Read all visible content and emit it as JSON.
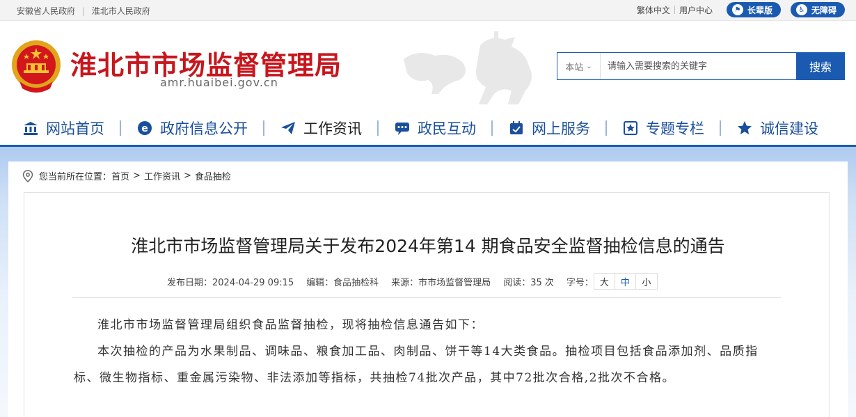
{
  "topbar": {
    "links_left": [
      "安徽省人民政府",
      "淮北市人民政府"
    ],
    "traditional": "繁体中文",
    "user_center": "用户中心",
    "elder_mode": "长辈版",
    "accessible": "无障碍"
  },
  "header": {
    "title": "淮北市市场监督管理局",
    "url": "amr.huaibei.gov.cn"
  },
  "search": {
    "scope": "本站",
    "placeholder": "请输入需要搜索的关键字",
    "button": "搜索"
  },
  "nav": {
    "items": [
      {
        "label": "网站首页",
        "icon": "bank-icon"
      },
      {
        "label": "政府信息公开",
        "icon": "e-icon"
      },
      {
        "label": "工作资讯",
        "icon": "paper-plane-icon"
      },
      {
        "label": "政民互动",
        "icon": "chat-icon"
      },
      {
        "label": "网上服务",
        "icon": "calendar-check-icon"
      },
      {
        "label": "专题专栏",
        "icon": "star-box-icon"
      },
      {
        "label": "诚信建设",
        "icon": "star-icon"
      }
    ],
    "active_index": 2
  },
  "breadcrumb": {
    "prefix": "您当前所在位置：",
    "items": [
      "首页",
      "工作资讯",
      "食品抽检"
    ]
  },
  "article": {
    "title": "淮北市市场监督管理局关于发布2024年第14 期食品安全监督抽检信息的通告",
    "date": "发布日期：2024-04-29 09:15",
    "editor": "编辑：食品抽检科",
    "source": "来源：市市场监督管理局",
    "views": "阅读：35 次",
    "font_label": "字号：",
    "font_sizes": [
      "大",
      "中",
      "小"
    ],
    "paragraphs": [
      "淮北市市场监督管理局组织食品监督抽检，现将抽检信息通告如下：",
      "本次抽检的产品为水果制品、调味品、粮食加工品、肉制品、饼干等14大类食品。抽检项目包括食品添加剂、品质指标、微生物指标、重金属污染物、非法添加等指标，共抽检74批次产品，其中72批次合格,2批次不合格。"
    ]
  },
  "colors": {
    "brand_blue": "#1a5bb1",
    "title_red": "#c8161d"
  }
}
